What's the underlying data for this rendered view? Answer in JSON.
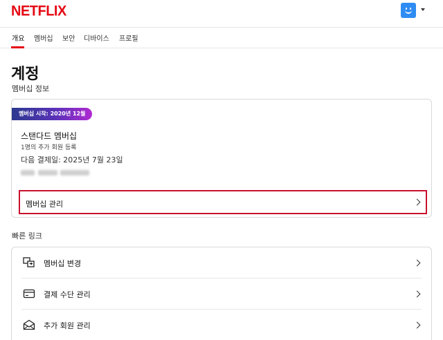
{
  "header": {
    "logo_text": "NETFLIX",
    "brand_color": "#e50914",
    "avatar_color": "#2f8cf3"
  },
  "tabs": [
    {
      "label": "개요",
      "active": true
    },
    {
      "label": "멤버십",
      "active": false
    },
    {
      "label": "보안",
      "active": false
    },
    {
      "label": "디바이스",
      "active": false
    },
    {
      "label": "프로필",
      "active": false
    }
  ],
  "page": {
    "title": "계정",
    "subtitle": "멤버십 정보"
  },
  "membership": {
    "badge": "멤버십 시작: 2020년 12월",
    "plan": "스탠다드 멤버십",
    "extra_member": "1명의 추가 회원 등록",
    "next_payment": "다음 결제일: 2025년 7월 23일",
    "manage_label": "멤버십 관리"
  },
  "quick_links": {
    "title": "빠른 링크",
    "items": [
      {
        "label": "멤버십 변경",
        "icon": "change-plan-icon"
      },
      {
        "label": "결제 수단 관리",
        "icon": "credit-card-icon"
      },
      {
        "label": "추가 회원 관리",
        "icon": "envelope-icon"
      }
    ]
  }
}
